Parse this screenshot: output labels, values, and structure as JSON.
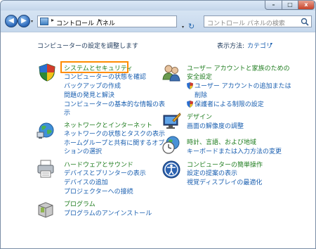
{
  "window": {
    "minimize_glyph": "–",
    "maximize_glyph": "□",
    "close_glyph": "x"
  },
  "address": {
    "back_glyph": "◀",
    "forward_glyph": "▶",
    "path": "コントロール パネル",
    "separator": "▸",
    "dropdown_glyph": "▾",
    "refresh_glyph": "↻"
  },
  "search": {
    "placeholder": "コントロール パネルの検索"
  },
  "header": {
    "title": "コンピューターの設定を調整します",
    "view_label": "表示方法:",
    "view_value": "カテゴリ",
    "view_caret": "▾"
  },
  "categories": [
    {
      "title": "システムとセキュリティ",
      "links": [
        "コンピューターの状態を確認",
        "バックアップの作成",
        "問題の発見と解決",
        "コンピューターの基本的な情報の表",
        "示"
      ]
    },
    {
      "title": "ネットワークとインターネット",
      "links": [
        "ネットワークの状態とタスクの表示",
        "ホームグループと共有に関するオプ",
        "ションの選択"
      ]
    },
    {
      "title": "ハードウェアとサウンド",
      "links": [
        "デバイスとプリンターの表示",
        "デバイスの追加",
        "プロジェクターへの接続"
      ]
    },
    {
      "title": "プログラム",
      "links": [
        "プログラムのアンインストール"
      ]
    },
    {
      "title_line1": "ユーザー アカウントと家族のための",
      "title_line2": "安全設定",
      "links": [
        "ユーザー アカウントの追加または",
        "削除",
        "保護者による制限の設定"
      ]
    },
    {
      "title": "デザイン",
      "links": [
        "画面の解像度の調整"
      ]
    },
    {
      "title": "時計、言語、および地域",
      "links": [
        "キーボードまたは入力方法の変更"
      ]
    },
    {
      "title": "コンピューターの簡単操作",
      "links": [
        "設定の提案の表示",
        "視覚ディスプレイの最適化"
      ]
    }
  ],
  "colors": {
    "highlight": "#ff8c00",
    "link": "#1a5fb0",
    "category_title": "#1f7d1f"
  }
}
